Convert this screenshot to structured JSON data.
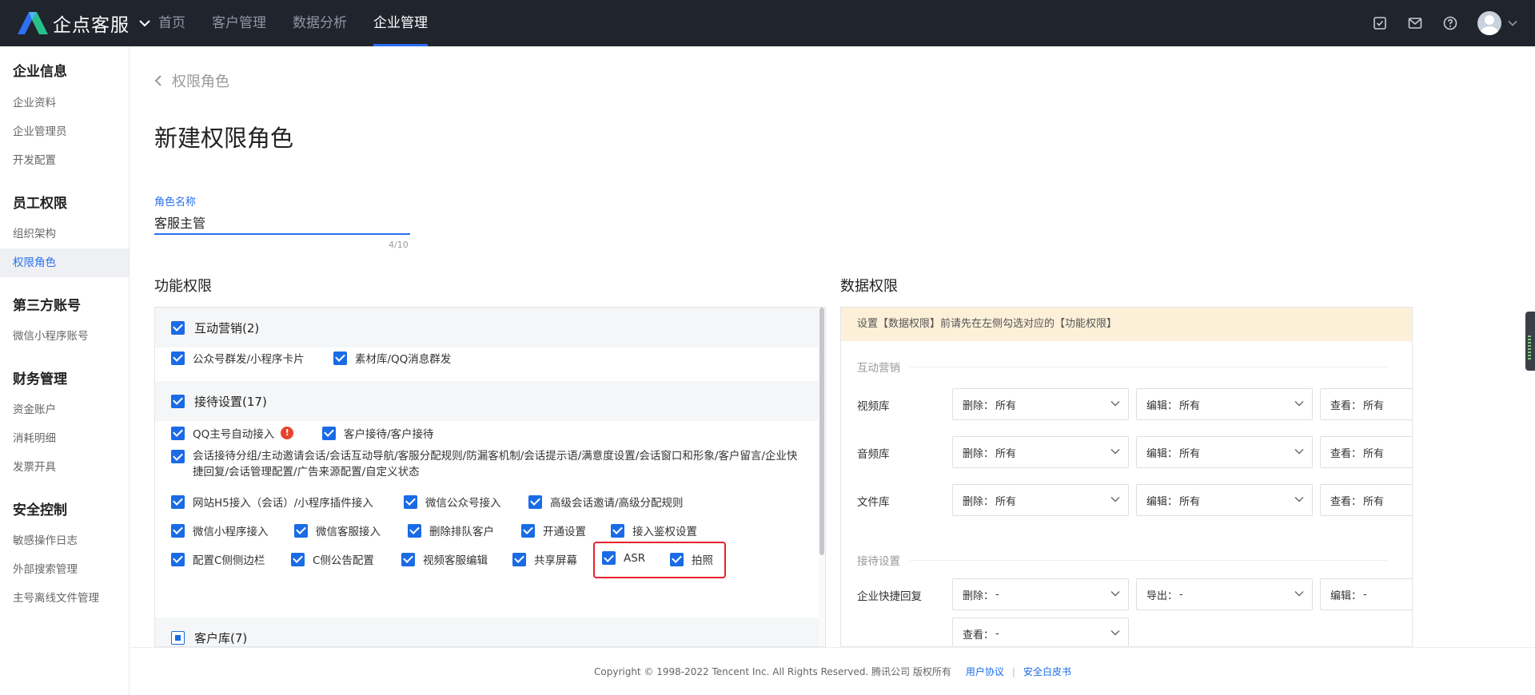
{
  "topbar": {
    "brand": "企点客服",
    "nav": [
      {
        "label": "首页",
        "active": false
      },
      {
        "label": "客户管理",
        "active": false
      },
      {
        "label": "数据分析",
        "active": false
      },
      {
        "label": "企业管理",
        "active": true
      }
    ],
    "icons": [
      "task-check-icon",
      "mail-icon",
      "help-icon"
    ]
  },
  "sidebar": {
    "groups": [
      {
        "title": "企业信息",
        "items": [
          "企业资料",
          "企业管理员",
          "开发配置"
        ]
      },
      {
        "title": "员工权限",
        "items": [
          "组织架构",
          "权限角色"
        ]
      },
      {
        "title": "第三方账号",
        "items": [
          "微信小程序账号"
        ]
      },
      {
        "title": "财务管理",
        "items": [
          "资金账户",
          "消耗明细",
          "发票开具"
        ]
      },
      {
        "title": "安全控制",
        "items": [
          "敏感操作日志",
          "外部搜索管理",
          "主号离线文件管理"
        ]
      }
    ],
    "active_item": "权限角色"
  },
  "main": {
    "breadcrumb": "权限角色",
    "title": "新建权限角色",
    "role_name_label": "角色名称",
    "role_name_value": "客服主管",
    "role_name_count": "4/10",
    "func_title": "功能权限",
    "data_title": "数据权限"
  },
  "func": {
    "groups": [
      {
        "label": "互动营销(2)",
        "state": "checked"
      },
      {
        "label": "接待设置(17)",
        "state": "checked"
      },
      {
        "label": "客户库(7)",
        "state": "partial"
      }
    ],
    "options": {
      "hd1": "公众号群发/小程序卡片",
      "hd2": "素材库/QQ消息群发",
      "r1a": "QQ主号自动接入",
      "r1b": "客户接待/客户接待",
      "r2": "会话接待分组/主动邀请会话/会话互动导航/客服分配规则/防漏客机制/会话提示语/满意度设置/会话窗口和形象/客户留言/企业快捷回复/会话管理配置/广告来源配置/自定义状态",
      "r3a": "网站H5接入（会话）/小程序插件接入",
      "r3b": "微信公众号接入",
      "r3c": "高级会话邀请/高级分配规则",
      "r4a": "微信小程序接入",
      "r4b": "微信客服接入",
      "r4c": "删除排队客户",
      "r4d": "开通设置",
      "r4e": "接入鉴权设置",
      "r5a": "配置C侧侧边栏",
      "r5b": "C侧公告配置",
      "r5c": "视频客服编辑",
      "r5d": "共享屏幕",
      "r5e": "ASR",
      "r5f": "拍照"
    },
    "warning_mark": "!",
    "highlighted_option": "接入鉴权设置"
  },
  "data": {
    "notice": "设置【数据权限】前请先在左侧勾选对应的【功能权限】",
    "group1": "互动营销",
    "group2": "接待设置",
    "rows": {
      "video": {
        "label": "视频库",
        "del": "删除：",
        "del_v": "所有",
        "edit": "编辑：",
        "edit_v": "所有",
        "view": "查看：",
        "view_v": "所有"
      },
      "audio": {
        "label": "音频库",
        "del": "删除：",
        "del_v": "所有",
        "edit": "编辑：",
        "edit_v": "所有",
        "view": "查看：",
        "view_v": "所有"
      },
      "file": {
        "label": "文件库",
        "del": "删除：",
        "del_v": "所有",
        "edit": "编辑：",
        "edit_v": "所有",
        "view": "查看：",
        "view_v": "所有"
      },
      "quick": {
        "label": "企业快捷回复",
        "del": "删除：",
        "del_v": "-",
        "export": "导出：",
        "export_v": "-",
        "edit": "编辑：",
        "edit_v": "-",
        "view": "查看：",
        "view_v": "-"
      }
    }
  },
  "footer": {
    "copyright": "Copyright © 1998-2022 Tencent Inc. All Rights Reserved. 腾讯公司 版权所有",
    "link1": "用户协议",
    "separator": "|",
    "link2": "安全白皮书"
  }
}
